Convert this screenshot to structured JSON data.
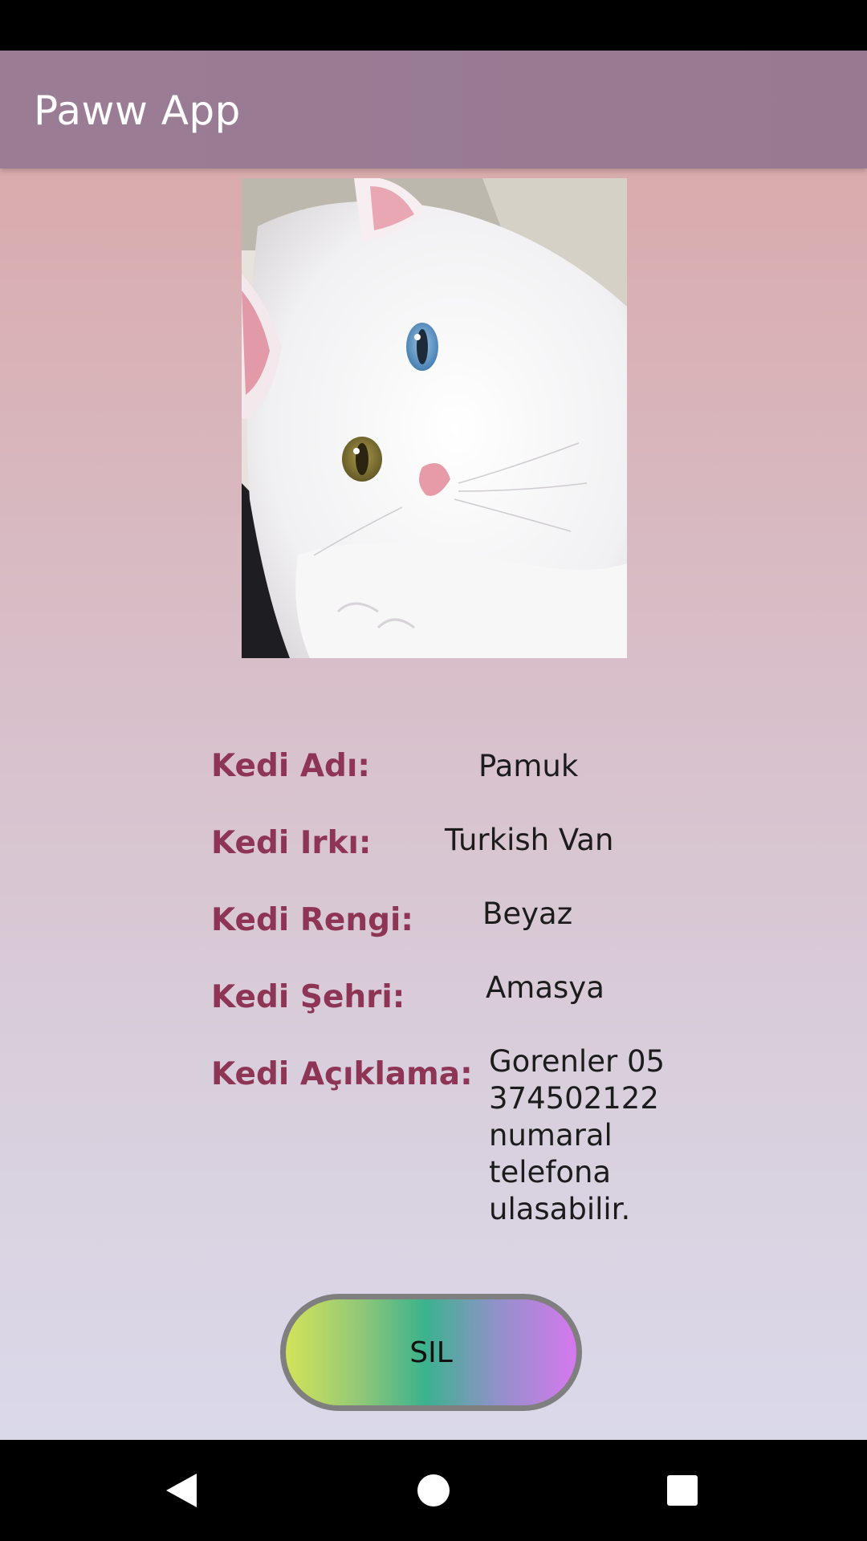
{
  "app": {
    "title": "Paww App"
  },
  "cat": {
    "fields": [
      {
        "label": "Kedi Adı:",
        "value": "Pamuk"
      },
      {
        "label": "Kedi Irkı:",
        "value": "Turkish Van"
      },
      {
        "label": "Kedi Rengi:",
        "value": "Beyaz"
      },
      {
        "label": "Kedi Şehri:",
        "value": "Amasya"
      },
      {
        "label": "Kedi Açıklama:",
        "value": "Gorenler 05 374502122 numaral telefona ulasabilir."
      }
    ]
  },
  "actions": {
    "delete_label": "SIL"
  },
  "nav": {
    "back_icon": "back-icon",
    "home_icon": "home-icon",
    "recents_icon": "recents-icon"
  },
  "colors": {
    "app_bar": "#9a7c95",
    "label": "#8e3556"
  }
}
